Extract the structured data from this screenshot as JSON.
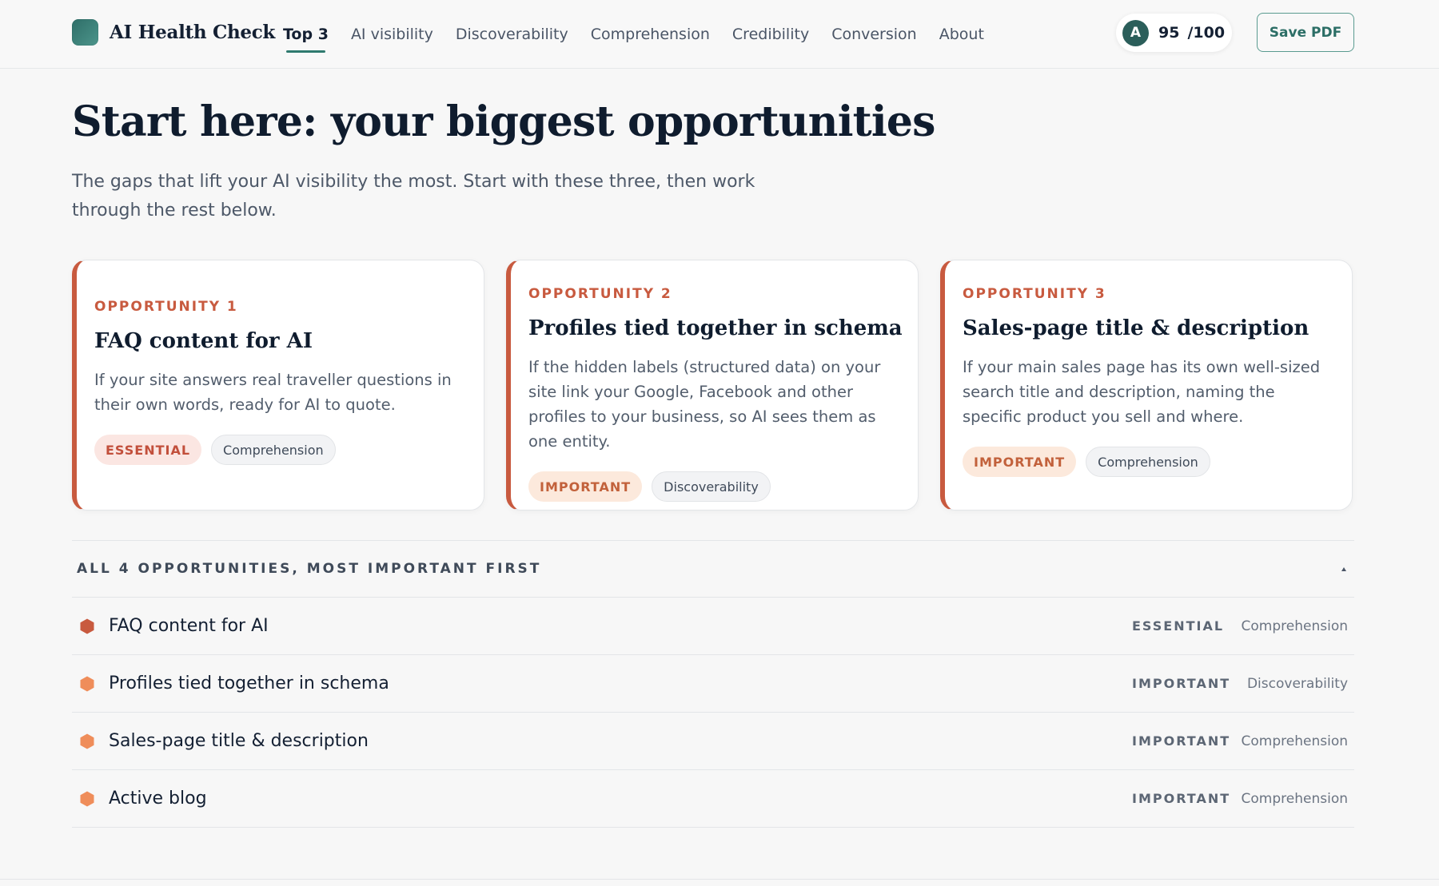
{
  "header": {
    "brand": "AI Health Check",
    "nav": [
      "Top 3",
      "AI visibility",
      "Discoverability",
      "Comprehension",
      "Credibility",
      "Conversion",
      "About"
    ],
    "active_nav": "Top 3",
    "score": {
      "avatar_letter": "A",
      "value": "95",
      "max": "/100"
    },
    "save_label": "Save PDF"
  },
  "hero": {
    "title": "Start here: your biggest opportunities",
    "subtitle": "The gaps that lift your AI visibility the most. Start with these three, then work through the rest below."
  },
  "cards": [
    {
      "eyebrow": "OPPORTUNITY 1",
      "title": "FAQ content for AI",
      "description": "If your site answers real traveller questions in their own words, ready for AI to quote.",
      "priority": "ESSENTIAL",
      "category": "Comprehension"
    },
    {
      "eyebrow": "OPPORTUNITY 2",
      "title": "Profiles tied together in schema",
      "description": "If the hidden labels (structured data) on your site link your Google, Facebook and other profiles to your business, so AI sees them as one entity.",
      "priority": "IMPORTANT",
      "category": "Discoverability"
    },
    {
      "eyebrow": "OPPORTUNITY 3",
      "title": "Sales-page title & description",
      "description": "If your main sales page has its own well-sized search title and description, naming the specific product you sell and where.",
      "priority": "IMPORTANT",
      "category": "Comprehension"
    }
  ],
  "list": {
    "header": "ALL 4 OPPORTUNITIES, MOST IMPORTANT FIRST",
    "rows": [
      {
        "title": "FAQ content for AI",
        "priority": "ESSENTIAL",
        "category": "Comprehension"
      },
      {
        "title": "Profiles tied together in schema",
        "priority": "IMPORTANT",
        "category": "Discoverability"
      },
      {
        "title": "Sales-page title & description",
        "priority": "IMPORTANT",
        "category": "Comprehension"
      },
      {
        "title": "Active blog",
        "priority": "IMPORTANT",
        "category": "Comprehension"
      }
    ]
  },
  "colors": {
    "accent": "#2f7a6f",
    "essential": "#c85a3f",
    "important": "#ef8d5a"
  }
}
